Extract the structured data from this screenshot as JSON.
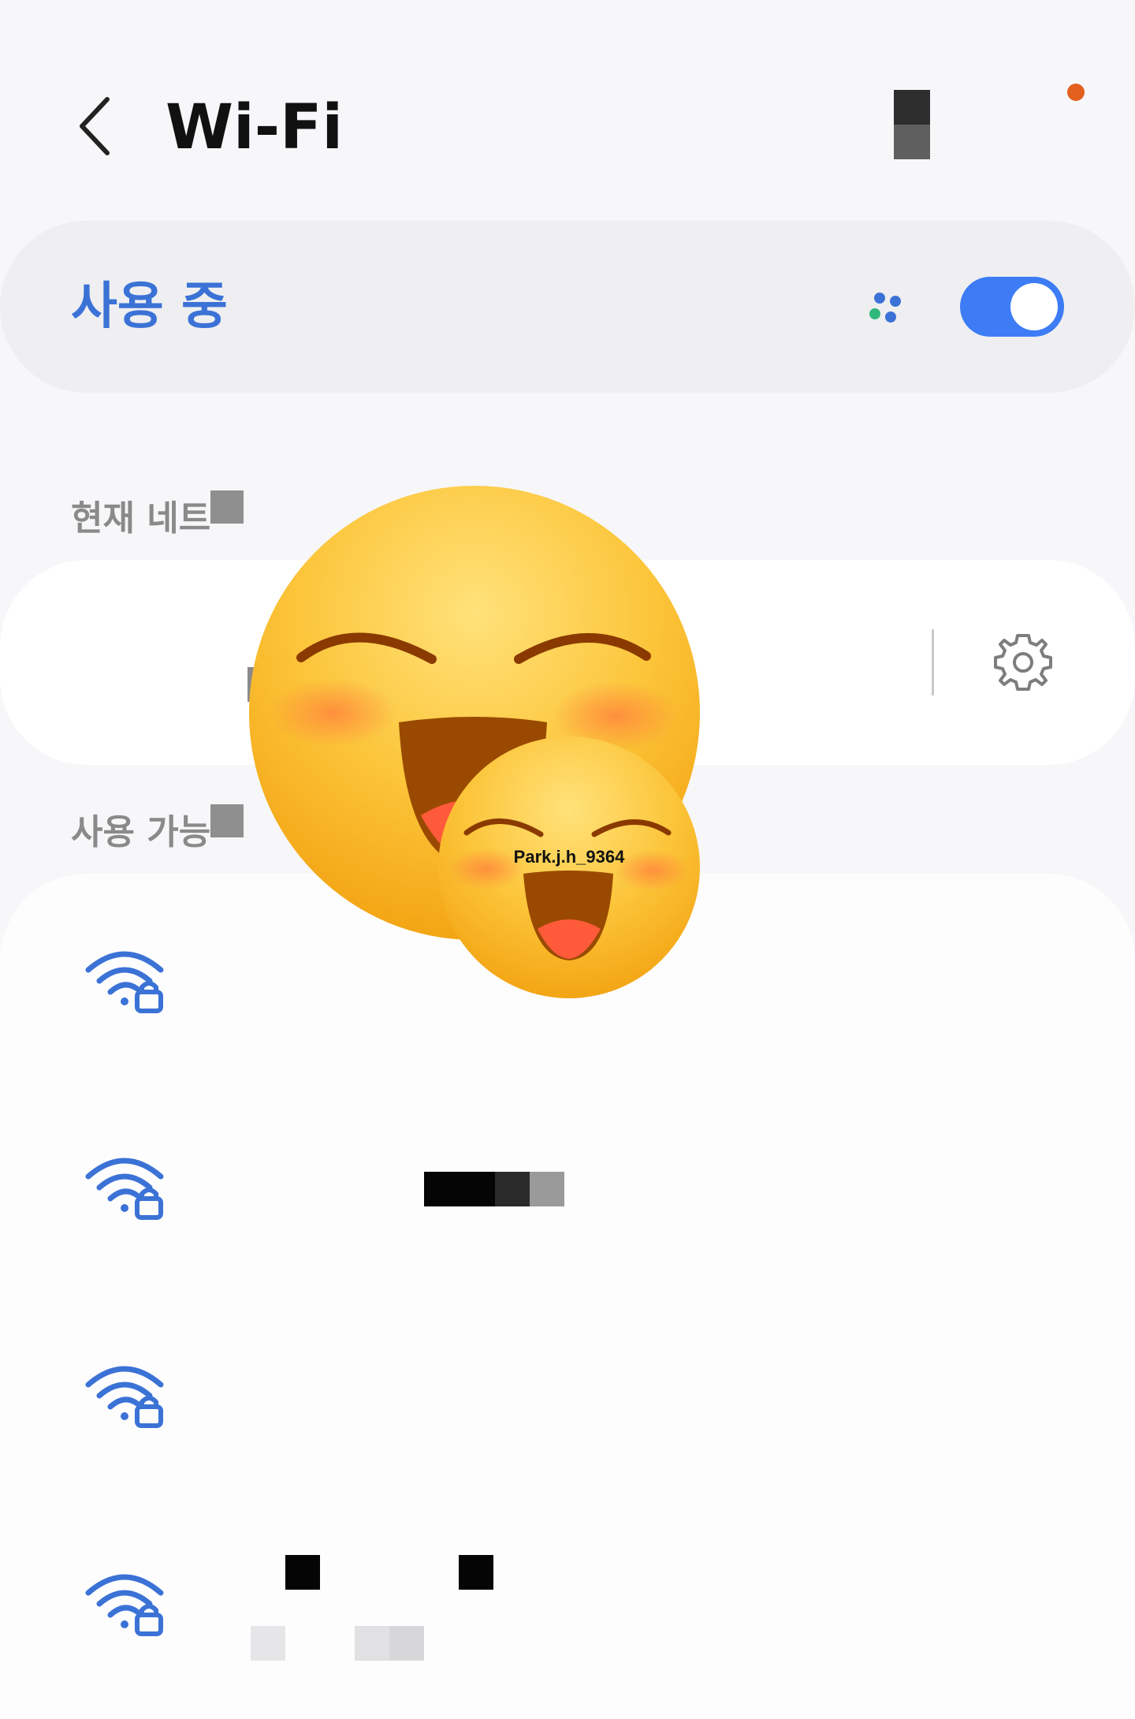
{
  "header": {
    "title": "Wi-Fi",
    "back_icon": "chevron-left-icon"
  },
  "master_toggle": {
    "label": "사용 중",
    "state": "on",
    "accent_color": "#3d7cf5"
  },
  "sections": {
    "current": {
      "title": "현재 네트"
    },
    "available": {
      "title": "사용 가능"
    }
  },
  "current_network": {
    "icon": "wifi-lock-icon",
    "settings_icon": "gear-icon"
  },
  "available_networks": [
    {
      "icon": "wifi-lock-icon"
    },
    {
      "icon": "wifi-lock-icon"
    },
    {
      "icon": "wifi-lock-icon"
    },
    {
      "icon": "wifi-lock-icon"
    }
  ],
  "sticker": {
    "watermark": "Park.j.h_9364"
  },
  "colors": {
    "background": "#f7f7f9",
    "card": "#ffffff",
    "wifi_icon": "#3b72d6",
    "notification_dot": "#e4601e"
  }
}
